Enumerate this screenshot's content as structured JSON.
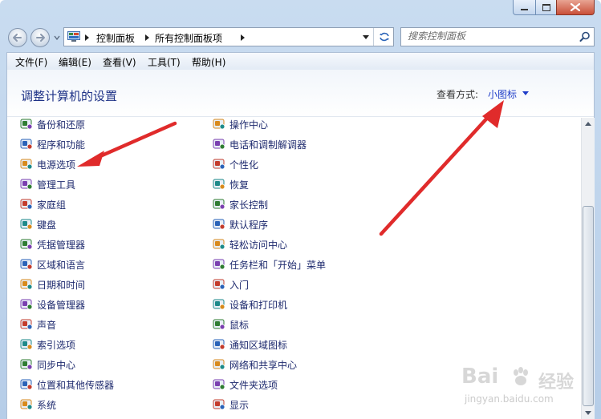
{
  "nav": {
    "breadcrumbs": [
      "控制面板",
      "所有控制面板项"
    ],
    "search_placeholder": "搜索控制面板"
  },
  "menu": [
    "文件(F)",
    "编辑(E)",
    "查看(V)",
    "工具(T)",
    "帮助(H)"
  ],
  "content": {
    "title": "调整计算机的设置",
    "view_by_label": "查看方式:",
    "view_by_value": "小图标"
  },
  "items_left": [
    {
      "label": "备份和还原",
      "icon": "backup-restore-icon"
    },
    {
      "label": "程序和功能",
      "icon": "programs-features-icon"
    },
    {
      "label": "电源选项",
      "icon": "power-options-icon"
    },
    {
      "label": "管理工具",
      "icon": "admin-tools-icon"
    },
    {
      "label": "家庭组",
      "icon": "homegroup-icon"
    },
    {
      "label": "键盘",
      "icon": "keyboard-icon"
    },
    {
      "label": "凭据管理器",
      "icon": "credential-manager-icon"
    },
    {
      "label": "区域和语言",
      "icon": "region-language-icon"
    },
    {
      "label": "日期和时间",
      "icon": "date-time-icon"
    },
    {
      "label": "设备管理器",
      "icon": "device-manager-icon"
    },
    {
      "label": "声音",
      "icon": "sound-icon"
    },
    {
      "label": "索引选项",
      "icon": "indexing-options-icon"
    },
    {
      "label": "同步中心",
      "icon": "sync-center-icon"
    },
    {
      "label": "位置和其他传感器",
      "icon": "location-sensors-icon"
    },
    {
      "label": "系统",
      "icon": "system-icon"
    }
  ],
  "items_right": [
    {
      "label": "操作中心",
      "icon": "action-center-icon"
    },
    {
      "label": "电话和调制解调器",
      "icon": "phone-modem-icon"
    },
    {
      "label": "个性化",
      "icon": "personalization-icon"
    },
    {
      "label": "恢复",
      "icon": "recovery-icon"
    },
    {
      "label": "家长控制",
      "icon": "parental-controls-icon"
    },
    {
      "label": "默认程序",
      "icon": "default-programs-icon"
    },
    {
      "label": "轻松访问中心",
      "icon": "ease-of-access-icon"
    },
    {
      "label": "任务栏和「开始」菜单",
      "icon": "taskbar-start-icon"
    },
    {
      "label": "入门",
      "icon": "getting-started-icon"
    },
    {
      "label": "设备和打印机",
      "icon": "devices-printers-icon"
    },
    {
      "label": "鼠标",
      "icon": "mouse-icon"
    },
    {
      "label": "通知区域图标",
      "icon": "notification-area-icon"
    },
    {
      "label": "网络和共享中心",
      "icon": "network-sharing-icon"
    },
    {
      "label": "文件夹选项",
      "icon": "folder-options-icon"
    },
    {
      "label": "显示",
      "icon": "display-icon"
    }
  ],
  "watermark": {
    "brand": "Bai",
    "text": "经验",
    "url": "jingyan.baidu.com"
  },
  "colors": {
    "link": "#1e2a6e",
    "title": "#1e3287",
    "accent": "#1e3cc8",
    "arrow": "#e02b2b"
  }
}
